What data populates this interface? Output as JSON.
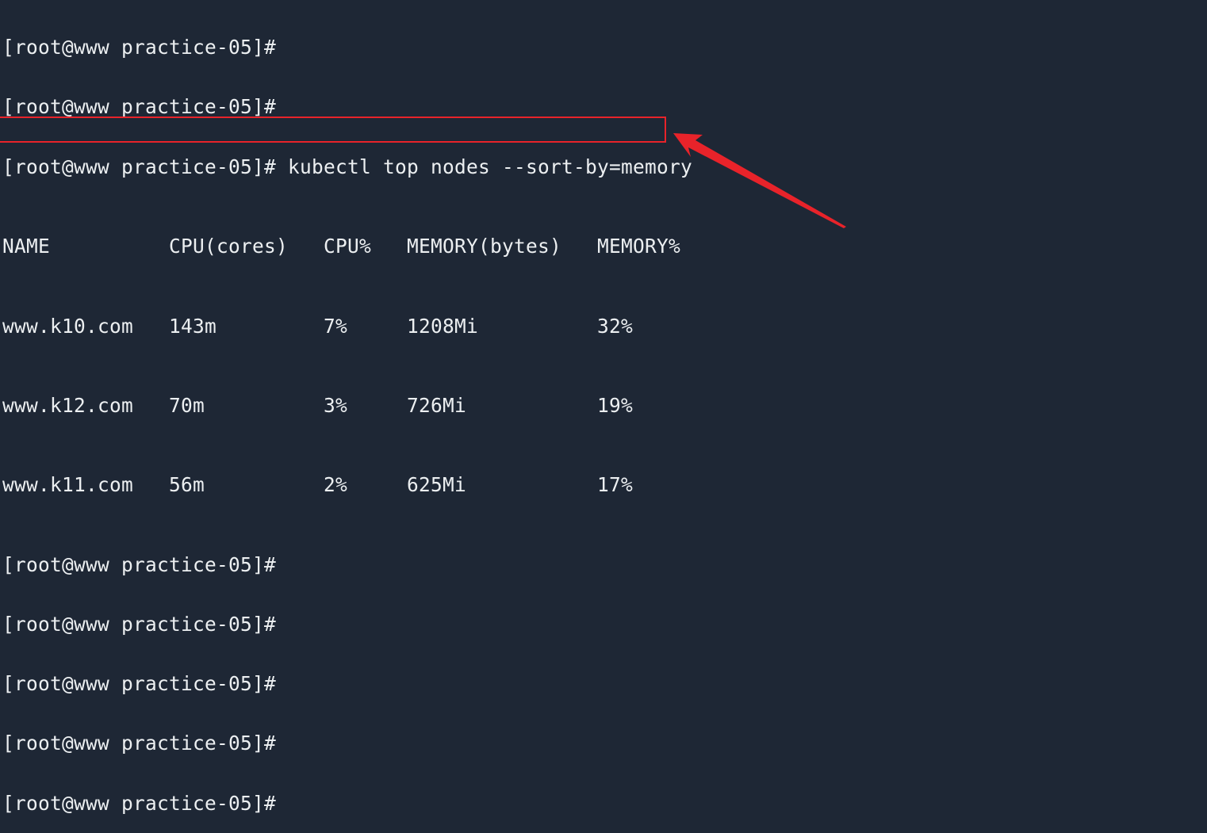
{
  "terminal": {
    "prompt": "[root@www practice-05]#",
    "lines_before": [
      {
        "prompt": "[root@www practice-05]#",
        "command": ""
      },
      {
        "prompt": "[root@www practice-05]#",
        "command": ""
      },
      {
        "prompt": "[root@www practice-05]#",
        "command": " kubectl top nodes --sort-by=memory"
      }
    ],
    "table": {
      "headers": [
        "NAME",
        "CPU(cores)",
        "CPU%",
        "MEMORY(bytes)",
        "MEMORY%"
      ],
      "rows": [
        [
          "www.k10.com",
          "143m",
          "7%",
          "1208Mi",
          "32%"
        ],
        [
          "www.k12.com",
          "70m",
          "3%",
          "726Mi",
          "19%"
        ],
        [
          "www.k11.com",
          "56m",
          "2%",
          "625Mi",
          "17%"
        ]
      ]
    },
    "lines_after": [
      {
        "prompt": "[root@www practice-05]#",
        "command": ""
      },
      {
        "prompt": "[root@www practice-05]#",
        "command": ""
      },
      {
        "prompt": "[root@www practice-05]#",
        "command": ""
      },
      {
        "prompt": "[root@www practice-05]#",
        "command": ""
      },
      {
        "prompt": "[root@www practice-05]#",
        "command": ""
      }
    ]
  },
  "annotation": {
    "highlighted_row": "www.k11.com",
    "color": "#e8232a",
    "icon": "arrow-pointer-icon"
  },
  "colors": {
    "background": "#1e2735",
    "text": "#eceff1",
    "annotation": "#e8232a"
  }
}
